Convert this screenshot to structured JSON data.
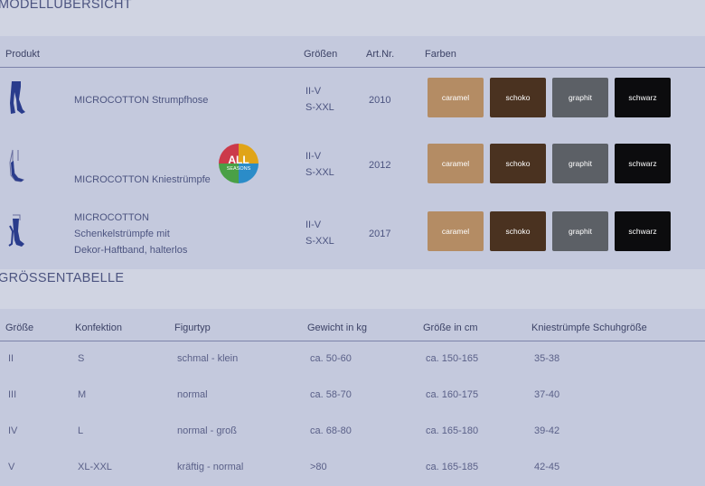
{
  "models": {
    "title": "MODELLÜBERSICHT",
    "headers": {
      "produkt": "Produkt",
      "groessen": "Größen",
      "artnr": "Art.Nr.",
      "farben": "Farben"
    },
    "rows": [
      {
        "icon": "pantyhose-icon",
        "name_lines": [
          "MICROCOTTON Strumpfhose"
        ],
        "sizes": [
          "II-V",
          "S-XXL"
        ],
        "artnr": "2010",
        "colors": [
          "caramel",
          "schoko",
          "graphit",
          "schwarz"
        ]
      },
      {
        "icon": "knee-sock-icon",
        "name_lines": [
          "MICROCOTTON Kniestrümpfe"
        ],
        "sizes": [
          "II-V",
          "S-XXL"
        ],
        "artnr": "2012",
        "badge": {
          "line1": "ALL",
          "line2": "SEASONS"
        },
        "colors": [
          "caramel",
          "schoko",
          "graphit",
          "schwarz"
        ]
      },
      {
        "icon": "thigh-stocking-icon",
        "name_lines": [
          "MICROCOTTON",
          "Schenkelstrümpfe mit",
          "Dekor-Haftband, halterlos"
        ],
        "sizes": [
          "II-V",
          "S-XXL"
        ],
        "artnr": "2017",
        "colors": [
          "caramel",
          "schoko",
          "graphit",
          "schwarz"
        ]
      }
    ],
    "color_hex": {
      "caramel": "#b48c64",
      "schoko": "#4a3220",
      "graphit": "#5c6066",
      "schwarz": "#0c0c0e"
    }
  },
  "sizes": {
    "title": "GRÖSSENTABELLE",
    "headers": [
      "Größe",
      "Konfektion",
      "Figurtyp",
      "Gewicht in kg",
      "Größe in cm",
      "Kniestrümpfe Schuhgröße"
    ],
    "rows": [
      [
        "II",
        "S",
        "schmal - klein",
        "ca. 50-60",
        "ca. 150-165",
        "35-38"
      ],
      [
        "III",
        "M",
        "normal",
        "ca. 58-70",
        "ca. 160-175",
        "37-40"
      ],
      [
        "IV",
        "L",
        "normal - groß",
        "ca. 68-80",
        "ca. 165-180",
        "39-42"
      ],
      [
        "V",
        "XL-XXL",
        "kräftig - normal",
        ">80",
        "ca. 165-185",
        "42-45"
      ]
    ]
  }
}
